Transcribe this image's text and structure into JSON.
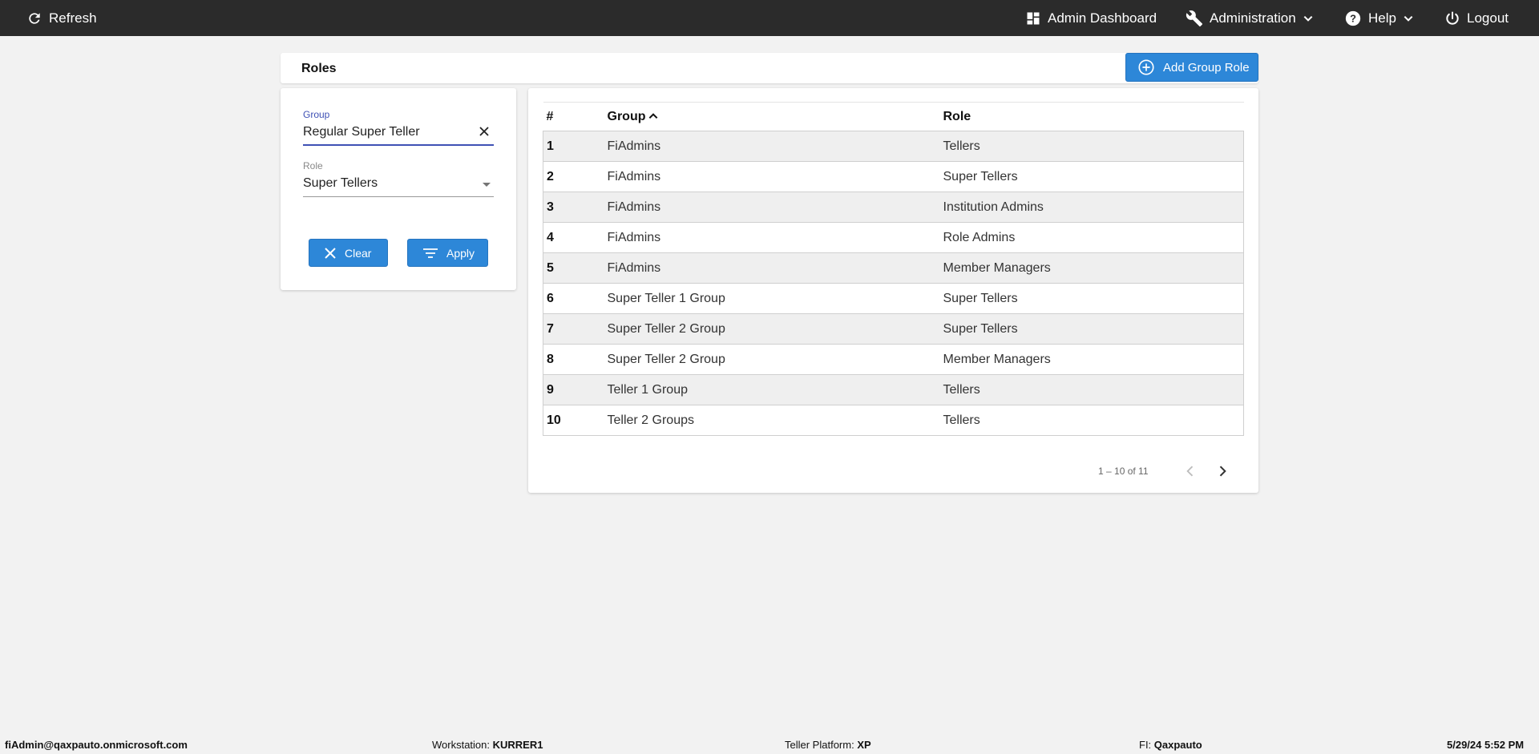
{
  "topbar": {
    "refresh_label": "Refresh",
    "dashboard_label": "Admin Dashboard",
    "administration_label": "Administration",
    "help_label": "Help",
    "logout_label": "Logout"
  },
  "page": {
    "title": "Roles",
    "add_button_label": "Add Group Role"
  },
  "filter": {
    "group_label": "Group",
    "group_value": "Regular Super Teller",
    "role_label": "Role",
    "role_value": "Super Tellers",
    "clear_label": "Clear",
    "apply_label": "Apply"
  },
  "table": {
    "columns": [
      "#",
      "Group",
      "Role"
    ],
    "sort_column": "Group",
    "sort_direction": "ascending",
    "rows": [
      {
        "num": "1",
        "group": "FiAdmins",
        "role": "Tellers"
      },
      {
        "num": "2",
        "group": "FiAdmins",
        "role": "Super Tellers"
      },
      {
        "num": "3",
        "group": "FiAdmins",
        "role": "Institution Admins"
      },
      {
        "num": "4",
        "group": "FiAdmins",
        "role": "Role Admins"
      },
      {
        "num": "5",
        "group": "FiAdmins",
        "role": "Member Managers"
      },
      {
        "num": "6",
        "group": "Super Teller 1 Group",
        "role": "Super Tellers"
      },
      {
        "num": "7",
        "group": "Super Teller 2 Group",
        "role": "Super Tellers"
      },
      {
        "num": "8",
        "group": "Super Teller 2 Group",
        "role": "Member Managers"
      },
      {
        "num": "9",
        "group": "Teller 1 Group",
        "role": "Tellers"
      },
      {
        "num": "10",
        "group": "Teller 2 Groups",
        "role": "Tellers"
      }
    ],
    "pagination": "1 – 10 of 11"
  },
  "footer": {
    "user": "fiAdmin@qaxpauto.onmicrosoft.com",
    "workstation_label": "Workstation: ",
    "workstation_value": "KURRER1",
    "platform_label": "Teller Platform: ",
    "platform_value": "XP",
    "fi_label": "FI: ",
    "fi_value": "Qaxpauto",
    "datetime": "5/29/24 5:52 PM"
  },
  "colors": {
    "topbar_bg": "#2b2b2b",
    "accent_blue": "#2d87d8",
    "focus_indigo": "#3f51b5",
    "page_bg": "#f2f2f2"
  }
}
